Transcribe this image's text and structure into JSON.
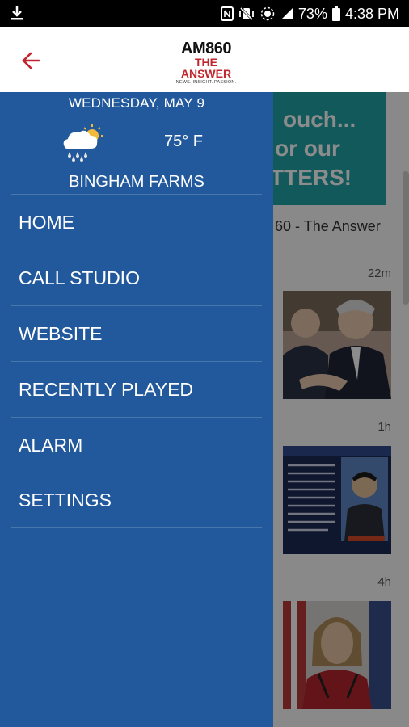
{
  "status_bar": {
    "battery": "73%",
    "time": "4:38 PM",
    "icons": [
      "download-icon",
      "nfc-icon",
      "vibrate-icon",
      "location-icon",
      "signal-icon",
      "battery-icon"
    ]
  },
  "header": {
    "logo": {
      "line1": "AM860",
      "line2": "THE ANSWER",
      "tagline": "NEWS. INSIGHT. PASSION."
    },
    "back_icon": "arrow-back-icon"
  },
  "drawer": {
    "date": "WEDNESDAY, MAY 9",
    "weather_icon": "rain-cloud-sun-icon",
    "temperature": "75° F",
    "location": "BINGHAM FARMS",
    "menu": [
      {
        "label": "HOME"
      },
      {
        "label": "CALL STUDIO"
      },
      {
        "label": "WEBSITE"
      },
      {
        "label": "RECENTLY PLAYED"
      },
      {
        "label": "ALARM"
      },
      {
        "label": "SETTINGS"
      }
    ]
  },
  "background": {
    "banner_lines": [
      "ouch...",
      "or our",
      "TTERS!"
    ],
    "feed_title": "60 - The Answer",
    "items": [
      {
        "time": "22m",
        "thumb": "kerry-hearing-photo"
      },
      {
        "time": "1h",
        "thumb": "north-korea-statement-graphic"
      },
      {
        "time": "4h",
        "thumb": "pelosi-photo"
      }
    ]
  },
  "colors": {
    "drawer": "#22599c",
    "accent": "#c0262d",
    "banner": "#20a3a7"
  }
}
